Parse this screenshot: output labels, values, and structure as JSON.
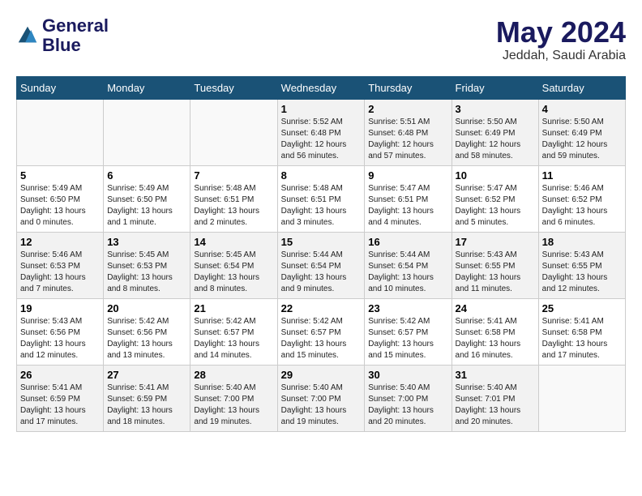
{
  "header": {
    "logo_line1": "General",
    "logo_line2": "Blue",
    "month_title": "May 2024",
    "location": "Jeddah, Saudi Arabia"
  },
  "weekdays": [
    "Sunday",
    "Monday",
    "Tuesday",
    "Wednesday",
    "Thursday",
    "Friday",
    "Saturday"
  ],
  "weeks": [
    [
      {
        "day": "",
        "info": ""
      },
      {
        "day": "",
        "info": ""
      },
      {
        "day": "",
        "info": ""
      },
      {
        "day": "1",
        "info": "Sunrise: 5:52 AM\nSunset: 6:48 PM\nDaylight: 12 hours\nand 56 minutes."
      },
      {
        "day": "2",
        "info": "Sunrise: 5:51 AM\nSunset: 6:48 PM\nDaylight: 12 hours\nand 57 minutes."
      },
      {
        "day": "3",
        "info": "Sunrise: 5:50 AM\nSunset: 6:49 PM\nDaylight: 12 hours\nand 58 minutes."
      },
      {
        "day": "4",
        "info": "Sunrise: 5:50 AM\nSunset: 6:49 PM\nDaylight: 12 hours\nand 59 minutes."
      }
    ],
    [
      {
        "day": "5",
        "info": "Sunrise: 5:49 AM\nSunset: 6:50 PM\nDaylight: 13 hours\nand 0 minutes."
      },
      {
        "day": "6",
        "info": "Sunrise: 5:49 AM\nSunset: 6:50 PM\nDaylight: 13 hours\nand 1 minute."
      },
      {
        "day": "7",
        "info": "Sunrise: 5:48 AM\nSunset: 6:51 PM\nDaylight: 13 hours\nand 2 minutes."
      },
      {
        "day": "8",
        "info": "Sunrise: 5:48 AM\nSunset: 6:51 PM\nDaylight: 13 hours\nand 3 minutes."
      },
      {
        "day": "9",
        "info": "Sunrise: 5:47 AM\nSunset: 6:51 PM\nDaylight: 13 hours\nand 4 minutes."
      },
      {
        "day": "10",
        "info": "Sunrise: 5:47 AM\nSunset: 6:52 PM\nDaylight: 13 hours\nand 5 minutes."
      },
      {
        "day": "11",
        "info": "Sunrise: 5:46 AM\nSunset: 6:52 PM\nDaylight: 13 hours\nand 6 minutes."
      }
    ],
    [
      {
        "day": "12",
        "info": "Sunrise: 5:46 AM\nSunset: 6:53 PM\nDaylight: 13 hours\nand 7 minutes."
      },
      {
        "day": "13",
        "info": "Sunrise: 5:45 AM\nSunset: 6:53 PM\nDaylight: 13 hours\nand 8 minutes."
      },
      {
        "day": "14",
        "info": "Sunrise: 5:45 AM\nSunset: 6:54 PM\nDaylight: 13 hours\nand 8 minutes."
      },
      {
        "day": "15",
        "info": "Sunrise: 5:44 AM\nSunset: 6:54 PM\nDaylight: 13 hours\nand 9 minutes."
      },
      {
        "day": "16",
        "info": "Sunrise: 5:44 AM\nSunset: 6:54 PM\nDaylight: 13 hours\nand 10 minutes."
      },
      {
        "day": "17",
        "info": "Sunrise: 5:43 AM\nSunset: 6:55 PM\nDaylight: 13 hours\nand 11 minutes."
      },
      {
        "day": "18",
        "info": "Sunrise: 5:43 AM\nSunset: 6:55 PM\nDaylight: 13 hours\nand 12 minutes."
      }
    ],
    [
      {
        "day": "19",
        "info": "Sunrise: 5:43 AM\nSunset: 6:56 PM\nDaylight: 13 hours\nand 12 minutes."
      },
      {
        "day": "20",
        "info": "Sunrise: 5:42 AM\nSunset: 6:56 PM\nDaylight: 13 hours\nand 13 minutes."
      },
      {
        "day": "21",
        "info": "Sunrise: 5:42 AM\nSunset: 6:57 PM\nDaylight: 13 hours\nand 14 minutes."
      },
      {
        "day": "22",
        "info": "Sunrise: 5:42 AM\nSunset: 6:57 PM\nDaylight: 13 hours\nand 15 minutes."
      },
      {
        "day": "23",
        "info": "Sunrise: 5:42 AM\nSunset: 6:57 PM\nDaylight: 13 hours\nand 15 minutes."
      },
      {
        "day": "24",
        "info": "Sunrise: 5:41 AM\nSunset: 6:58 PM\nDaylight: 13 hours\nand 16 minutes."
      },
      {
        "day": "25",
        "info": "Sunrise: 5:41 AM\nSunset: 6:58 PM\nDaylight: 13 hours\nand 17 minutes."
      }
    ],
    [
      {
        "day": "26",
        "info": "Sunrise: 5:41 AM\nSunset: 6:59 PM\nDaylight: 13 hours\nand 17 minutes."
      },
      {
        "day": "27",
        "info": "Sunrise: 5:41 AM\nSunset: 6:59 PM\nDaylight: 13 hours\nand 18 minutes."
      },
      {
        "day": "28",
        "info": "Sunrise: 5:40 AM\nSunset: 7:00 PM\nDaylight: 13 hours\nand 19 minutes."
      },
      {
        "day": "29",
        "info": "Sunrise: 5:40 AM\nSunset: 7:00 PM\nDaylight: 13 hours\nand 19 minutes."
      },
      {
        "day": "30",
        "info": "Sunrise: 5:40 AM\nSunset: 7:00 PM\nDaylight: 13 hours\nand 20 minutes."
      },
      {
        "day": "31",
        "info": "Sunrise: 5:40 AM\nSunset: 7:01 PM\nDaylight: 13 hours\nand 20 minutes."
      },
      {
        "day": "",
        "info": ""
      }
    ]
  ]
}
